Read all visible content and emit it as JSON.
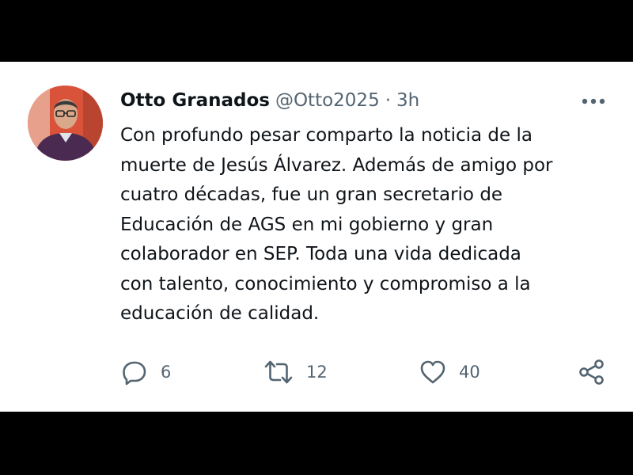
{
  "tweet": {
    "author_name": "Otto Granados",
    "handle": "@Otto2025",
    "separator": "·",
    "time": "3h",
    "text": "Con profundo pesar comparto la noticia de la\nmuerte de Jesús Álvarez. Además de amigo por\ncuatro décadas, fue un gran secretario de\nEducación de AGS en mi gobierno y gran\ncolaborador en SEP.  Toda una vida dedicada\ncon talento, conocimiento y compromiso a la\neducación de calidad.",
    "replies": "6",
    "retweets": "12",
    "likes": "40"
  },
  "icons": {
    "more": "more-horizontal-icon",
    "reply": "reply-icon",
    "retweet": "retweet-icon",
    "like": "heart-icon",
    "share": "share-icon"
  },
  "colors": {
    "background": "#000000",
    "card": "#ffffff",
    "text_primary": "#0f1419",
    "text_secondary": "#536471"
  }
}
